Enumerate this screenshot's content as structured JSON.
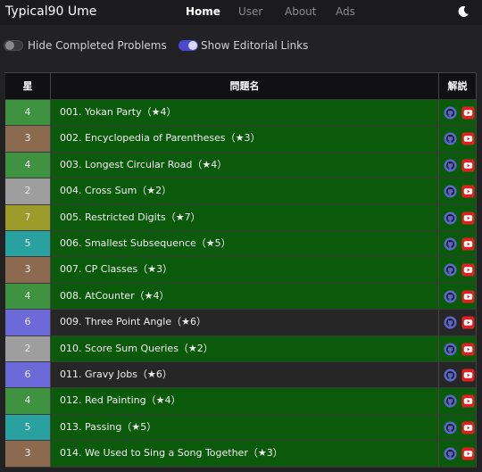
{
  "nav": {
    "brand": "Typical90 Ume",
    "links": [
      "Home",
      "User",
      "About",
      "Ads"
    ],
    "theme_icon": "moon-icon"
  },
  "toggles": {
    "hide_completed": {
      "label": "Hide Completed Problems",
      "on": false
    },
    "show_editorial": {
      "label": "Show Editorial Links",
      "on": true
    }
  },
  "table": {
    "headers": [
      "星",
      "問題名",
      "解説"
    ],
    "rows": [
      {
        "star": "4",
        "name": "001. Yokan Party（★4）",
        "status": "green"
      },
      {
        "star": "3",
        "name": "002. Encyclopedia of Parentheses（★3）",
        "status": "green"
      },
      {
        "star": "4",
        "name": "003. Longest Circular Road（★4）",
        "status": "green"
      },
      {
        "star": "2",
        "name": "004. Cross Sum（★2）",
        "status": "green"
      },
      {
        "star": "7",
        "name": "005. Restricted Digits（★7）",
        "status": "green"
      },
      {
        "star": "5",
        "name": "006. Smallest Subsequence（★5）",
        "status": "green"
      },
      {
        "star": "3",
        "name": "007. CP Classes（★3）",
        "status": "green"
      },
      {
        "star": "4",
        "name": "008. AtCounter（★4）",
        "status": "green"
      },
      {
        "star": "6",
        "name": "009. Three Point Angle（★6）",
        "status": "dark"
      },
      {
        "star": "2",
        "name": "010. Score Sum Queries（★2）",
        "status": "green"
      },
      {
        "star": "6",
        "name": "011. Gravy Jobs（★6）",
        "status": "dark"
      },
      {
        "star": "4",
        "name": "012. Red Painting（★4）",
        "status": "green"
      },
      {
        "star": "5",
        "name": "013. Passing（★5）",
        "status": "green"
      },
      {
        "star": "3",
        "name": "014. We Used to Sing a Song Together（★3）",
        "status": "green"
      }
    ],
    "link_icons": [
      "github-icon",
      "youtube-icon"
    ]
  },
  "colors": {
    "difficulty": {
      "2": "#9e9e9e",
      "3": "#8c6a4f",
      "4": "#3f923f",
      "5": "#2aa1a1",
      "6": "#6c6ad8",
      "7": "#9c9c2a"
    },
    "solved_row": "#0b5a0b",
    "unsolved_row": "#262626",
    "github": "#5a66c9",
    "youtube": "#e02020"
  }
}
